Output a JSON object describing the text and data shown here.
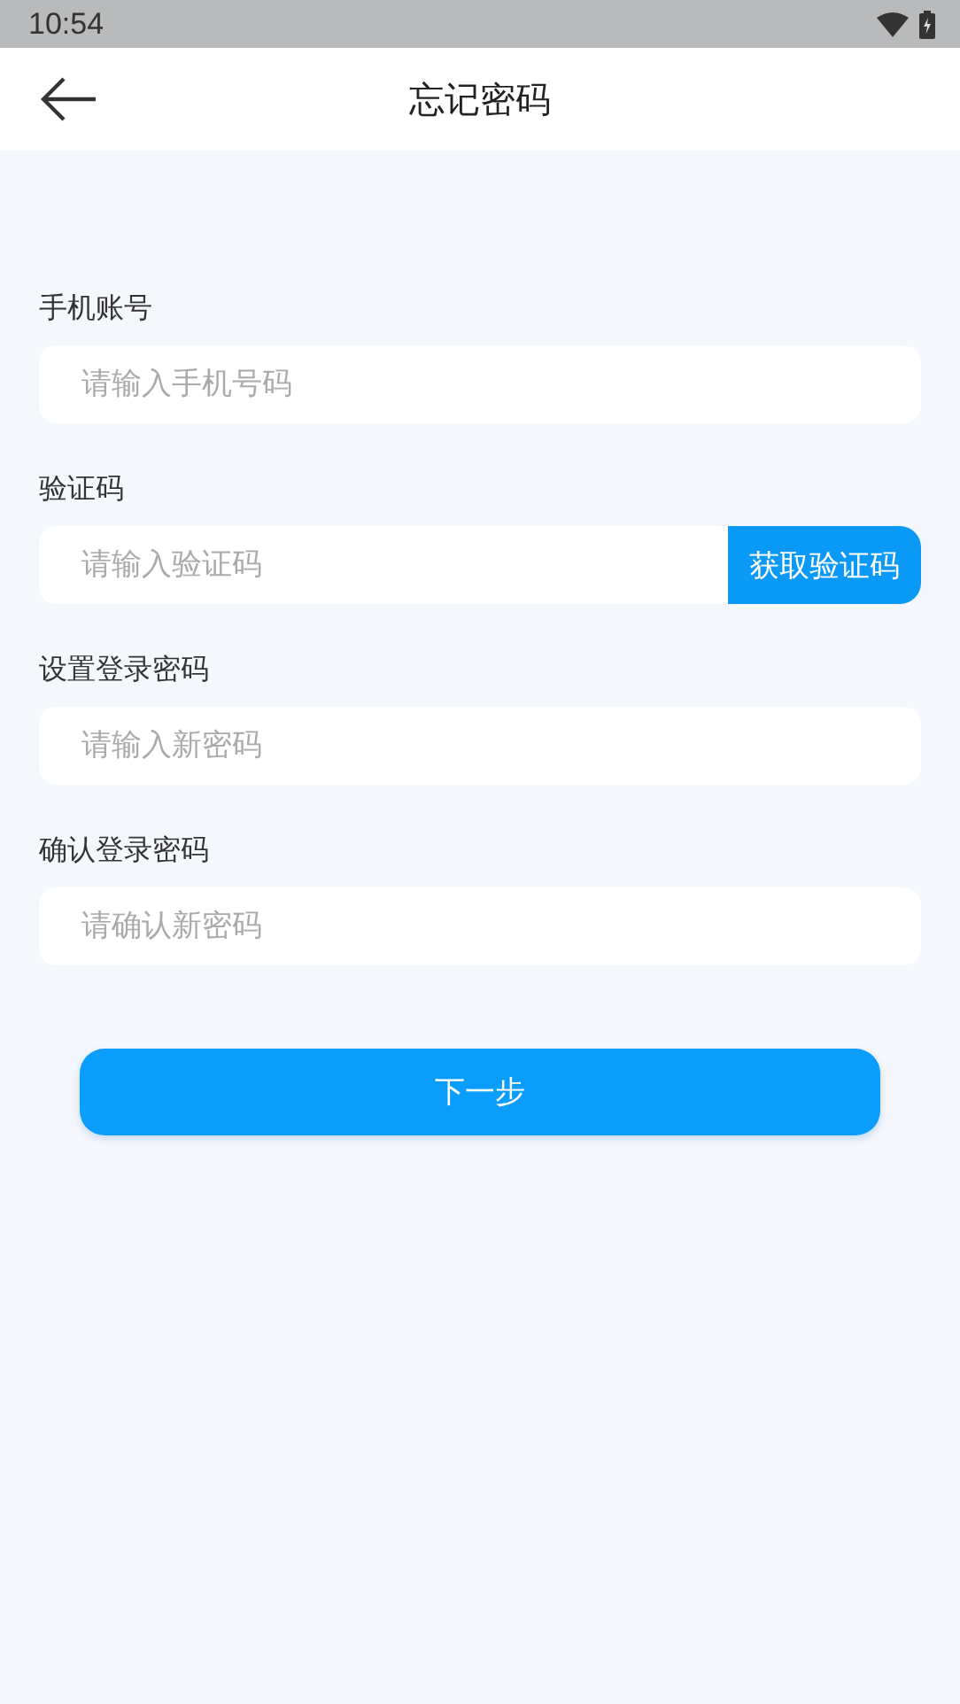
{
  "status_bar": {
    "time": "10:54"
  },
  "header": {
    "title": "忘记密码"
  },
  "fields": [
    {
      "kind": "text",
      "label": "手机账号",
      "placeholder": "请输入手机号码"
    },
    {
      "kind": "code",
      "label": "验证码",
      "placeholder": "请输入验证码",
      "button": "获取验证码"
    },
    {
      "kind": "text",
      "label": "设置登录密码",
      "placeholder": "请输入新密码"
    },
    {
      "kind": "text",
      "label": "确认登录密码",
      "placeholder": "请确认新密码"
    }
  ],
  "next_button": "下一步"
}
